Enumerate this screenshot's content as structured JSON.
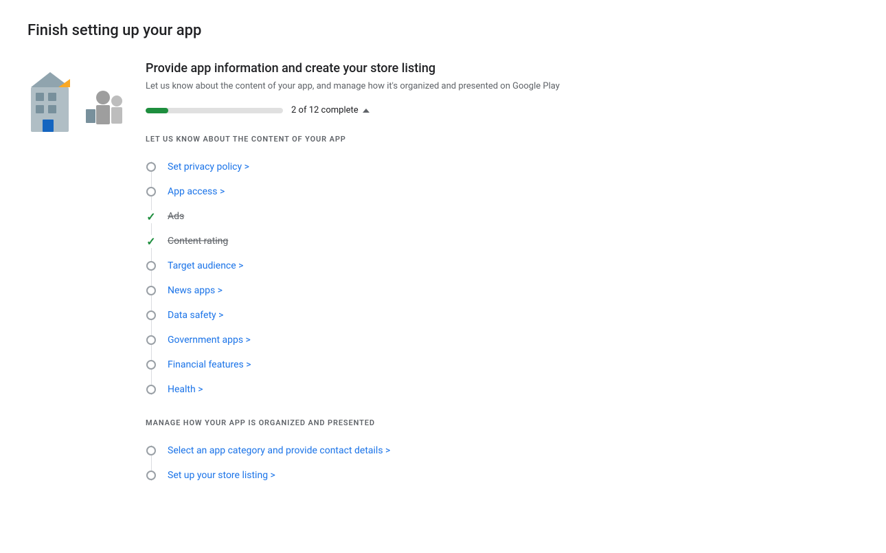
{
  "page": {
    "title": "Finish setting up your app"
  },
  "card": {
    "heading": "Provide app information and create your store listing",
    "subheading": "Let us know about the content of your app, and manage how it's organized and presented on Google Play"
  },
  "progress": {
    "current": 2,
    "total": 12,
    "label": "2 of 12 complete",
    "percent": 16.67
  },
  "section1": {
    "label": "LET US KNOW ABOUT THE CONTENT OF YOUR APP",
    "items": [
      {
        "id": "privacy-policy",
        "text": "Set privacy policy >",
        "status": "pending"
      },
      {
        "id": "app-access",
        "text": "App access >",
        "status": "pending"
      },
      {
        "id": "ads",
        "text": "Ads",
        "status": "done"
      },
      {
        "id": "content-rating",
        "text": "Content rating",
        "status": "done"
      },
      {
        "id": "target-audience",
        "text": "Target audience >",
        "status": "pending"
      },
      {
        "id": "news-apps",
        "text": "News apps >",
        "status": "pending"
      },
      {
        "id": "data-safety",
        "text": "Data safety >",
        "status": "pending"
      },
      {
        "id": "government-apps",
        "text": "Government apps >",
        "status": "pending"
      },
      {
        "id": "financial-features",
        "text": "Financial features >",
        "status": "pending"
      },
      {
        "id": "health",
        "text": "Health >",
        "status": "pending"
      }
    ]
  },
  "section2": {
    "label": "MANAGE HOW YOUR APP IS ORGANIZED AND PRESENTED",
    "items": [
      {
        "id": "app-category",
        "text": "Select an app category and provide contact details >",
        "status": "pending"
      },
      {
        "id": "store-listing",
        "text": "Set up your store listing >",
        "status": "pending"
      }
    ]
  }
}
